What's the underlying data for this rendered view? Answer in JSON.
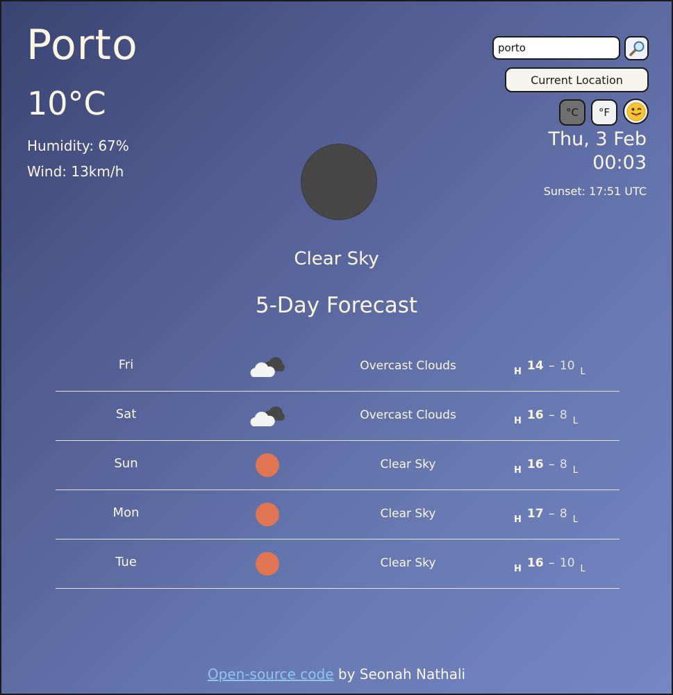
{
  "city": "Porto",
  "temperature": "10°C",
  "humidity": "Humidity: 67%",
  "wind": "Wind: 13km/h",
  "search": {
    "value": "porto"
  },
  "current_location_label": "Current Location",
  "units": {
    "celsius": "°C",
    "fahrenheit": "°F"
  },
  "date": "Thu, 3 Feb",
  "time": "00:03",
  "sunset": "Sunset: 17:51 UTC",
  "description": "Clear Sky",
  "forecast_title": "5-Day Forecast",
  "forecast": [
    {
      "day": "Fri",
      "icon": "cloud-icon",
      "desc": "Overcast Clouds",
      "h_label": "H",
      "high": "14",
      "low": "10",
      "l_label": "L"
    },
    {
      "day": "Sat",
      "icon": "cloud-icon",
      "desc": "Overcast Clouds",
      "h_label": "H",
      "high": "16",
      "low": "8",
      "l_label": "L"
    },
    {
      "day": "Sun",
      "icon": "sun-icon",
      "desc": "Clear Sky",
      "h_label": "H",
      "high": "16",
      "low": "8",
      "l_label": "L"
    },
    {
      "day": "Mon",
      "icon": "sun-icon",
      "desc": "Clear Sky",
      "h_label": "H",
      "high": "17",
      "low": "8",
      "l_label": "L"
    },
    {
      "day": "Tue",
      "icon": "sun-icon",
      "desc": "Clear Sky",
      "h_label": "H",
      "high": "16",
      "low": "10",
      "l_label": "L"
    }
  ],
  "footer": {
    "link_text": "Open-source code",
    "suffix": " by Seonah Nathali"
  },
  "colors": {
    "sun": "#e07554",
    "main_icon": "#474747",
    "link": "#8fc4ec",
    "text": "#fbf6e2"
  }
}
